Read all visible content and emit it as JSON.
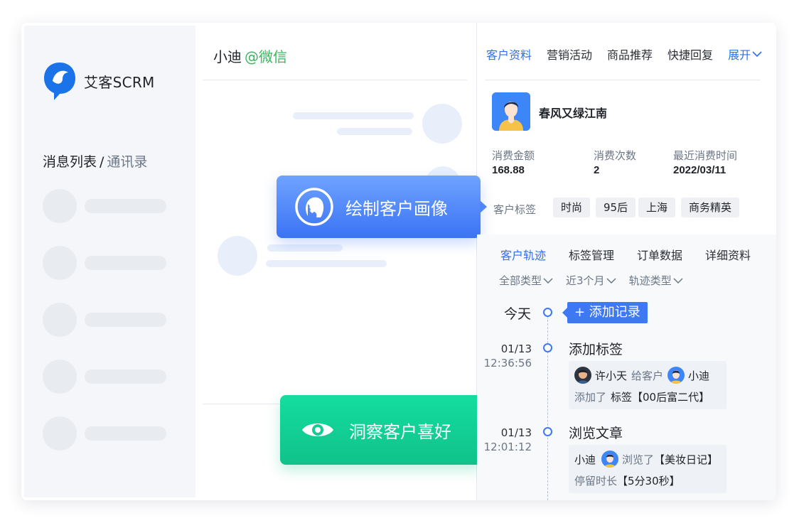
{
  "brand": {
    "name": "艾客SCRM",
    "logo_icon": "chat-bird-logo-icon",
    "accent": "#1a73e8"
  },
  "sidebar": {
    "list_label": "消息列表",
    "separator": "/",
    "contacts_label": "通讯录"
  },
  "chat": {
    "contact": "小迪",
    "platform": "@微信"
  },
  "callouts": {
    "portrait": "绘制客户画像",
    "insight": "洞察客户喜好"
  },
  "tabs": {
    "items": [
      "客户资料",
      "营销活动",
      "商品推荐",
      "快捷回复"
    ],
    "expand": "展开"
  },
  "customer": {
    "name": "春风又绿江南",
    "stats": [
      {
        "label": "消费金额",
        "value": "168.88"
      },
      {
        "label": "消费次数",
        "value": "2"
      },
      {
        "label": "最近消费时间",
        "value": "2022/03/11"
      }
    ],
    "tag_label": "客户标签",
    "tags": [
      "时尚",
      "95后",
      "上海",
      "商务精英"
    ]
  },
  "sub_tabs": [
    "客户轨迹",
    "标签管理",
    "订单数据",
    "详细资料"
  ],
  "filters": [
    "全部类型",
    "近3个月",
    "轨迹类型"
  ],
  "timeline": {
    "today": "今天",
    "add_record": "+ 添加记录",
    "events": [
      {
        "date": "01/13",
        "time": "12:36:56",
        "title": "添加标签",
        "actor": "许小天",
        "verb": "给客户",
        "target": "小迪",
        "action": "添加了",
        "detail": "标签【00后富二代】"
      },
      {
        "date": "01/13",
        "time": "12:01:12",
        "title": "浏览文章",
        "actor": "小迪",
        "verb": "浏览了",
        "detail": "【美妆日记】",
        "duration_label": "停留时长",
        "duration": "【5分30秒】"
      }
    ]
  }
}
